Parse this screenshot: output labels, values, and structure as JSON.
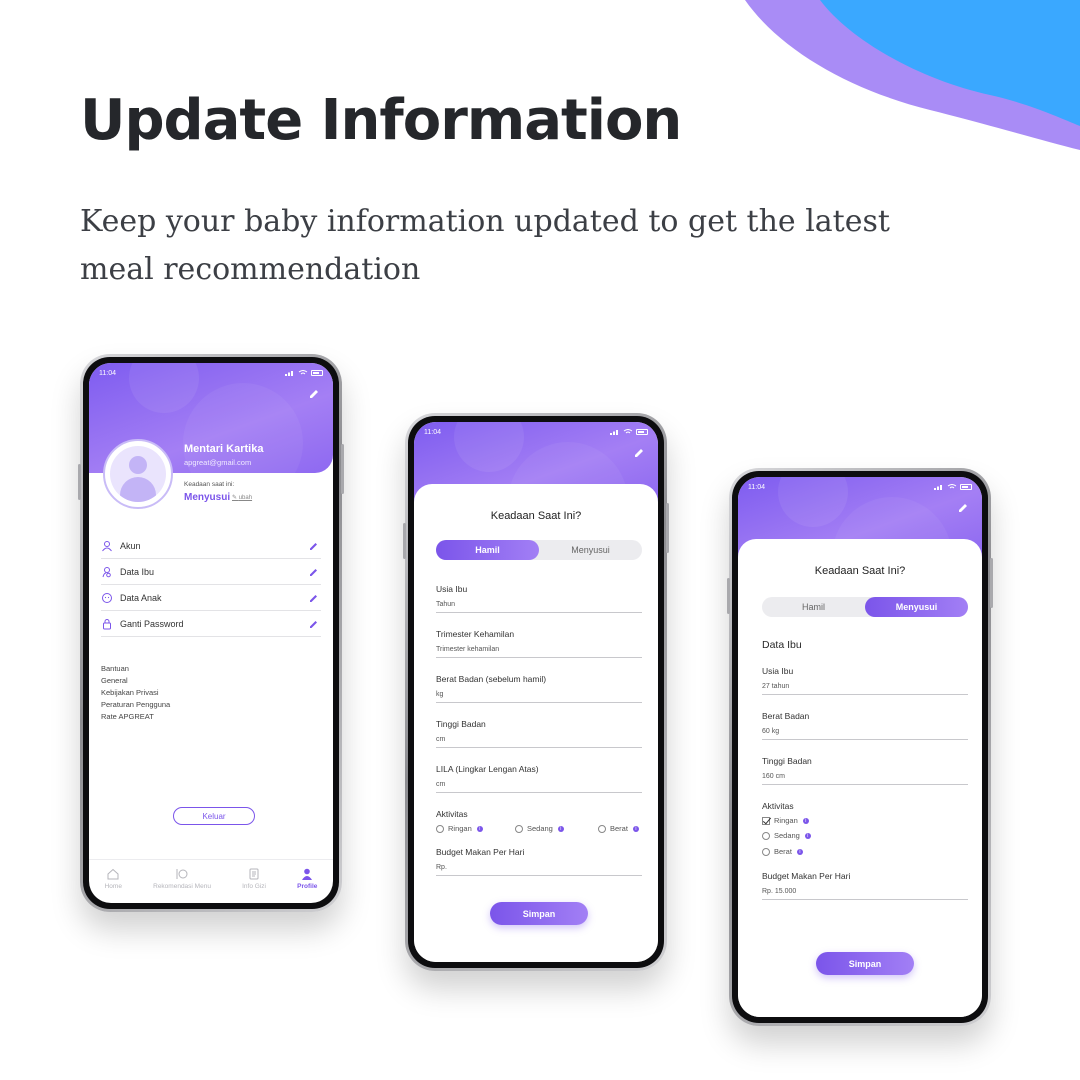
{
  "headline": "Update Information",
  "subline": "Keep your baby information updated to get the latest meal recommendation",
  "colors": {
    "accent": "#7b55ea",
    "blob_purple": "#a98cf6",
    "blob_blue": "#3aa8ff"
  },
  "status_time": "11:04",
  "profile": {
    "name": "Mentari Kartika",
    "email": "apgreat@gmail.com",
    "state_label": "Keadaan saat ini:",
    "state_value": "Menyusui",
    "state_edit": "ubah",
    "menu": [
      {
        "label": "Akun",
        "icon": "user-icon"
      },
      {
        "label": "Data Ibu",
        "icon": "mother-icon"
      },
      {
        "label": "Data Anak",
        "icon": "baby-icon"
      },
      {
        "label": "Ganti Password",
        "icon": "lock-icon"
      }
    ],
    "links": [
      "Bantuan",
      "General",
      "Kebijakan Privasi",
      "Peraturan Pengguna",
      "Rate APGREAT"
    ],
    "logout": "Keluar",
    "tabs": [
      "Home",
      "Rekomendasi Menu",
      "Info Gizi",
      "Profile"
    ]
  },
  "form_hamil": {
    "title": "Keadaan Saat Ini?",
    "seg": [
      "Hamil",
      "Menyusui"
    ],
    "fields": [
      {
        "label": "Usia Ibu",
        "value": "Tahun"
      },
      {
        "label": "Trimester Kehamilan",
        "value": "Trimester kehamilan"
      },
      {
        "label": "Berat Badan (sebelum hamil)",
        "value": "kg"
      },
      {
        "label": "Tinggi Badan",
        "value": "cm"
      },
      {
        "label": "LILA (Lingkar Lengan Atas)",
        "value": "cm"
      }
    ],
    "activity_label": "Aktivitas",
    "activities": [
      "Ringan",
      "Sedang",
      "Berat"
    ],
    "budget_label": "Budget Makan Per Hari",
    "budget_value": "Rp.",
    "save": "Simpan"
  },
  "form_menyusui": {
    "title": "Keadaan Saat Ini?",
    "seg": [
      "Hamil",
      "Menyusui"
    ],
    "section": "Data Ibu",
    "fields": [
      {
        "label": "Usia Ibu",
        "value": "27 tahun"
      },
      {
        "label": "Berat Badan",
        "value": "60 kg"
      },
      {
        "label": "Tinggi Badan",
        "value": "160 cm"
      }
    ],
    "activity_label": "Aktivitas",
    "activities": [
      "Ringan",
      "Sedang",
      "Berat"
    ],
    "budget_label": "Budget Makan Per Hari",
    "budget_value": "Rp. 15.000",
    "save": "Simpan"
  }
}
